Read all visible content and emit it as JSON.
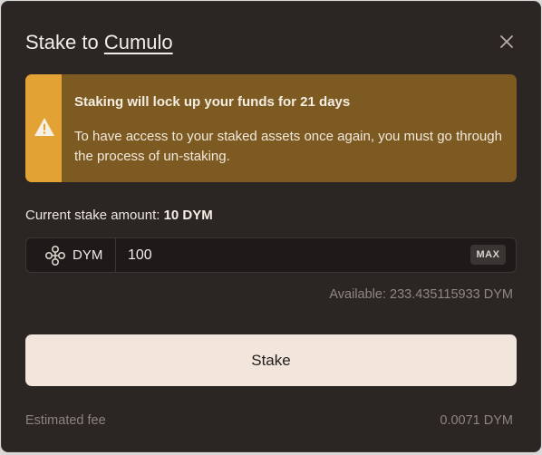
{
  "dialog": {
    "title_prefix": "Stake to",
    "validator_name": "Cumulo",
    "close_icon": "close-icon"
  },
  "warning": {
    "icon": "warning-triangle-icon",
    "title": "Staking will lock up your funds for 21 days",
    "text": "To have access to your staked assets once again, you must go through the process of un-staking."
  },
  "current_stake": {
    "label": "Current stake amount:",
    "value": "10 DYM"
  },
  "amount": {
    "token_icon": "dym-token-icon",
    "token": "DYM",
    "value": "100",
    "max_label": "MAX",
    "available": "Available: 233.435115933 DYM"
  },
  "stake_button": {
    "label": "Stake"
  },
  "fee": {
    "label": "Estimated fee",
    "value": "0.0071 DYM"
  },
  "colors": {
    "background": "#2b2624",
    "warning_bg": "#7d5a22",
    "warning_accent": "#e3a334",
    "button_bg": "#f2e5db"
  }
}
